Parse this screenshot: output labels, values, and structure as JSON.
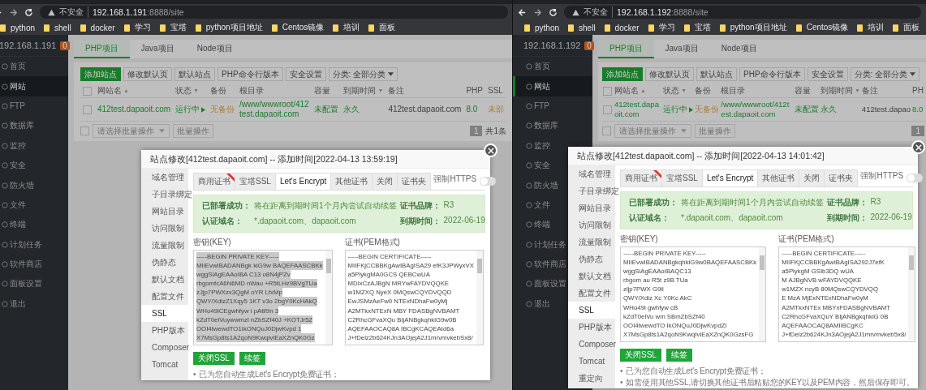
{
  "panes": [
    {
      "address": {
        "security": "不安全",
        "host": "192.168.1.191",
        "path": ":8888/site"
      },
      "bookmarks": [
        "python",
        "shell",
        "docker",
        "学习",
        "宝塔",
        "python项目地址",
        "Centos镜像",
        "培训",
        "面板"
      ],
      "sidebar": {
        "host": "192.168.1.191",
        "badge": "0",
        "items": [
          {
            "label": "首页",
            "selected": false
          },
          {
            "label": "网站",
            "selected": true
          },
          {
            "label": "FTP",
            "selected": false
          },
          {
            "label": "数据库",
            "selected": false
          },
          {
            "label": "监控",
            "selected": false
          },
          {
            "label": "安全",
            "selected": false
          },
          {
            "label": "防火墙",
            "selected": false
          },
          {
            "label": "文件",
            "selected": false
          },
          {
            "label": "终端",
            "selected": false
          },
          {
            "label": "计划任务",
            "selected": false
          },
          {
            "label": "软件商店",
            "selected": false
          },
          {
            "label": "面板设置",
            "selected": false
          },
          {
            "label": "退出",
            "selected": false
          }
        ]
      },
      "project_tabs": [
        {
          "label": "PHP项目",
          "selected": true
        },
        {
          "label": "Java项目",
          "selected": false
        },
        {
          "label": "Node项目",
          "selected": false
        }
      ],
      "toolbar": [
        {
          "label": "添加站点",
          "kind": "primary"
        },
        {
          "label": "修改默认页",
          "kind": "plain"
        },
        {
          "label": "默认站点",
          "kind": "plain"
        },
        {
          "label": "PHP命令行版本",
          "kind": "plain"
        },
        {
          "label": "安全设置",
          "kind": "plain"
        },
        {
          "label": "分类: 全部分类",
          "kind": "dropdown"
        }
      ],
      "table": {
        "all_checked": false,
        "columns": [
          {
            "label": "网站名",
            "sort_icon": "▲"
          },
          {
            "label": "状态",
            "sort_icon": "▼"
          },
          {
            "label": "备份"
          },
          {
            "label": "根目录"
          },
          {
            "label": "容量"
          },
          {
            "label": "到期时间",
            "sort_icon": "▼"
          },
          {
            "label": "备注"
          },
          {
            "label": "PHP"
          },
          {
            "label": "SSL"
          }
        ],
        "rows": [
          {
            "checked": false,
            "cells": [
              {
                "text": "412test.dapaoit.com",
                "kind": "link"
              },
              {
                "text": "运行中",
                "kind": "running"
              },
              {
                "text": "无备份",
                "kind": "warning"
              },
              {
                "text": "/www/wwwroot/412test.dapaoit.com",
                "kind": "link"
              },
              {
                "text": "未配置",
                "kind": "link"
              },
              {
                "text": "永久",
                "kind": "link"
              },
              {
                "text": "412test.dapaoit.com",
                "kind": "plain"
              },
              {
                "text": "8.0",
                "kind": "link"
              },
              {
                "text": "未部",
                "kind": "warning"
              }
            ]
          }
        ]
      },
      "footer": {
        "checked": false,
        "batch_placeholder": "请选择批量操作",
        "batch_button": "批量操作",
        "page": "1",
        "total": "共1条"
      },
      "modal": {
        "title": "站点修改[412test.dapaoit.com] -- 添加时间[2022-04-13 13:59:19]",
        "nav": [
          {
            "label": "域名管理",
            "selected": false
          },
          {
            "label": "子目录绑定",
            "selected": false
          },
          {
            "label": "网站目录",
            "selected": false
          },
          {
            "label": "访问限制",
            "selected": false
          },
          {
            "label": "流量限制",
            "selected": false
          },
          {
            "label": "伪静态",
            "selected": false
          },
          {
            "label": "默认文档",
            "selected": false
          },
          {
            "label": "配置文件",
            "selected": false
          },
          {
            "label": "SSL",
            "selected": true
          },
          {
            "label": "PHP版本",
            "selected": false
          },
          {
            "label": "Composer",
            "selected": false
          },
          {
            "label": "Tomcat",
            "selected": false
          }
        ],
        "ssl_tabs": [
          {
            "label": "商用证书",
            "selected": false,
            "ribbon": true
          },
          {
            "label": "宝塔SSL",
            "selected": false
          },
          {
            "label": "Let's Encrypt",
            "selected": true
          },
          {
            "label": "其他证书",
            "selected": false
          },
          {
            "label": "关闭",
            "selected": false
          },
          {
            "label": "证书夹",
            "selected": false
          }
        ],
        "force_https": {
          "label": "强制HTTPS",
          "on": false
        },
        "alert": {
          "deployed_label": "已部署成功：",
          "deployed_text": "将在距离到期时间1个月内尝试自动续签",
          "brand_label": "证书品牌：",
          "brand": "R3",
          "domains_label": "认证域名：",
          "domains": "*.dapaoit.com、dapaoit.com",
          "expiry_label": "到期时间：",
          "expiry": "2022-06-19"
        },
        "key": {
          "label": "密钥(KEY)",
          "selected": true,
          "lines": [
            "-----BEGIN PRIVATE KEY-----",
            "MIIEvwIBADANBgk  kiG9w  BAQEFAASCBKk",
            "wggSlAgEAAoIBA  C13  o8N4jPZv",
            "rbgomfcA6N6MD  nWau  +R5tLHz9BVgTUa",
            "zJjp7PWXzx3QgM  oYR  LfxMp",
            "QWY/XdizZ1Xqy5  1KT  v3o  2bgY0KcHAkQ",
            "WHo49iCEgwhfyw  i  pAtil9n  3",
            "kZdT0elVuywwmzl  nZbSZf40J  +KOTJr5Z",
            "OOI4twewdTO1IkONQuJ0DjwKvpd  1",
            "X7MsGp8ts1A2qoN9KwqIviEaXZnQK0Gz"
          ]
        },
        "cert": {
          "label": "证书(PEM格式)",
          "selected": false,
          "lines": [
            "-----BEGIN CERTIFICATE-----",
            "MIIFKjCCBBKgAwIBAgISA29  efK3JPWyxVX",
            "a5PlykgMA0GCS  QEBCwUA",
            "MDIxCzAJBgN  MRYwFAYDVQQKE",
            "w1MZXQ  NyeX  0MQswCQYDVQQD",
            "EwJSMzAeFw0  NTExNDhaFw0yMj",
            "A2MTkxNTExN  MBY  FDASBgNVBAMT",
            "C2RhcGFvaXQu  BIjANBgkqhkiG9w0B",
            "AQEFAAOCAQ8A  IBCgKCAQEAtd6a",
            "J+fDelz2b624KJn3AOjejA2J1mrvmvkebSx8/"
          ]
        },
        "buttons": [
          "关闭SSL",
          "续签"
        ],
        "notes": [
          {
            "bullet": "•",
            "text": "已为您自动生成Let's Encrypt免费证书；"
          }
        ]
      }
    },
    {
      "address": {
        "security": "不安全",
        "host": "192.168.1.192",
        "path": ":8888/site"
      },
      "bookmarks": [
        "python",
        "shell",
        "docker",
        "学习",
        "宝塔",
        "python项目地址",
        "Centos镜像",
        "培训",
        "面板"
      ],
      "sidebar": {
        "host": "192.168.1.192",
        "badge": "0",
        "items": [
          {
            "label": "首页",
            "selected": false
          },
          {
            "label": "网站",
            "selected": true
          },
          {
            "label": "FTP",
            "selected": false
          },
          {
            "label": "数据库",
            "selected": false
          },
          {
            "label": "监控",
            "selected": false
          },
          {
            "label": "安全",
            "selected": false
          },
          {
            "label": "防火墙",
            "selected": false
          },
          {
            "label": "文件",
            "selected": false
          },
          {
            "label": "终端",
            "selected": false
          },
          {
            "label": "计划任务",
            "selected": false
          },
          {
            "label": "软件商店",
            "selected": false
          },
          {
            "label": "面板设置",
            "selected": false
          },
          {
            "label": "退出",
            "selected": false
          }
        ]
      },
      "project_tabs": [
        {
          "label": "PHP项目",
          "selected": true
        },
        {
          "label": "Java项目",
          "selected": false
        },
        {
          "label": "Node项目",
          "selected": false
        }
      ],
      "toolbar": [
        {
          "label": "添加站点",
          "kind": "primary"
        },
        {
          "label": "修改默认页",
          "kind": "plain"
        },
        {
          "label": "默认站点",
          "kind": "plain"
        },
        {
          "label": "PHP命令行版本",
          "kind": "plain"
        },
        {
          "label": "安全设置",
          "kind": "plain"
        },
        {
          "label": "分类: 全部分类",
          "kind": "dropdown"
        }
      ],
      "table": {
        "all_checked": false,
        "columns": [
          {
            "label": "网站名",
            "sort_icon": "▲"
          },
          {
            "label": "状态",
            "sort_icon": "▼"
          },
          {
            "label": "备份"
          },
          {
            "label": "根目录"
          },
          {
            "label": "容量"
          },
          {
            "label": "到期时间",
            "sort_icon": "▼"
          },
          {
            "label": "备注"
          },
          {
            "label": "PH"
          }
        ],
        "rows": [
          {
            "checked": false,
            "cells": [
              {
                "text": "412test.dapaoit.com",
                "kind": "link"
              },
              {
                "text": "运行中",
                "kind": "running"
              },
              {
                "text": "无备份",
                "kind": "warning"
              },
              {
                "text": "/www/wwwroot/412test.dapaoit.com",
                "kind": "link"
              },
              {
                "text": "未配置",
                "kind": "link"
              },
              {
                "text": "永久",
                "kind": "link"
              },
              {
                "text": "412test.dapao",
                "kind": "plain"
              },
              {
                "text": "8.0",
                "kind": "link"
              }
            ]
          }
        ]
      },
      "footer": {
        "checked": false,
        "batch_placeholder": "请选择批量操作",
        "batch_button": "批量操作",
        "page": "1"
      },
      "modal": {
        "title": "站点修改[412test.dapaoit.com] -- 添加时间[2022-04-13 14:01:42]",
        "nav": [
          {
            "label": "域名管理",
            "selected": false
          },
          {
            "label": "子目录绑定",
            "selected": false
          },
          {
            "label": "网站目录",
            "selected": false
          },
          {
            "label": "访问限制",
            "selected": false
          },
          {
            "label": "流量限制",
            "selected": false
          },
          {
            "label": "伪静态",
            "selected": false
          },
          {
            "label": "默认文档",
            "selected": false
          },
          {
            "label": "配置文件",
            "selected": false
          },
          {
            "label": "SSL",
            "selected": true
          },
          {
            "label": "PHP版本",
            "selected": false
          },
          {
            "label": "Composer",
            "selected": false
          },
          {
            "label": "Tomcat",
            "selected": false
          },
          {
            "label": "重定向",
            "selected": false
          }
        ],
        "ssl_tabs": [
          {
            "label": "商用证书",
            "selected": false,
            "ribbon": true
          },
          {
            "label": "宝塔SSL",
            "selected": false
          },
          {
            "label": "Let's Encrypt",
            "selected": true
          },
          {
            "label": "其他证书",
            "selected": false
          },
          {
            "label": "关闭",
            "selected": false
          },
          {
            "label": "证书夹",
            "selected": false
          }
        ],
        "force_https": {
          "label": "强制HTTPS",
          "on": false
        },
        "alert": {
          "deployed_label": "已部署成功：",
          "deployed_text": "将在距离到期时间1个月内尝试自动续签",
          "brand_label": "证书品牌：",
          "brand": "R3",
          "domains_label": "认证域名：",
          "domains": "*.dapaoit.com、dapaoit.com",
          "expiry_label": "到期时间：",
          "expiry": "2022-06-19"
        },
        "key": {
          "label": "密钥(KEY)",
          "selected": false,
          "lines": [
            "-----BEGIN PRIVATE KEY-----",
            "MIIEvwIBADANBgkqhkiG9w0BAQEFAASCBKk",
            "wggSlAgEAAoIBAQC13",
            "rbgom  au  R5t  z9B  TUa",
            "zljp7PWX  G9il",
            "QWY/Xdiz  Xc  Y0Kc  AkC",
            "WHo49i  gwhfyw  cB",
            "kZdT0elVu  wm  SBmZbSZf40",
            "OOI4twewdTO  IkONQuJ0DjwKvpdZl",
            "X7MsGp8ts1A2qoN9KwqIviEaXZnQK0GzsFG"
          ]
        },
        "cert": {
          "label": "证书(PEM格式)",
          "selected": false,
          "lines": [
            "-----BEGIN CERTIFICATE-----",
            "MIIFKjCCBBKgAwIBAgISA292J7efK",
            "a5PlykgM  GSIb3DQ  wUA",
            "M  AJBgNVB  wFAYDVQQKE",
            "w1MZX  ncyB  80MQswCQYDVQQ",
            "E  MzA  MjExNTExNDhaFw0yM",
            "A2MTkxNTEx  MBYxFDASBgNVBAMT",
            "C2RhcGFvaXQuY  BIjANBgkqhkiG  0B",
            "AQEFAAOCAQ8AMIIBCgKC",
            "J+fDelz2b624KJn3AOjejA2J1mrvmvkeb5x8/"
          ]
        },
        "buttons": [
          "关闭SSL",
          "续签"
        ],
        "notes": [
          {
            "bullet": "•",
            "text": "已为您自动生成Let's Encrypt免费证书；"
          },
          {
            "bullet": "•",
            "text": "如需使用其他SSL,请切换其他证书后粘贴您的KEY以及PEM内容，然后保存即可。"
          }
        ]
      }
    }
  ]
}
